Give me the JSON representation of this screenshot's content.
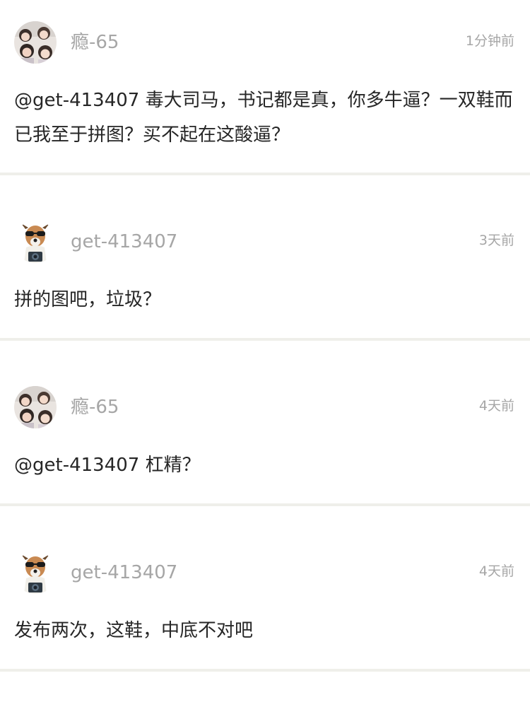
{
  "comments": [
    {
      "username": "瘾-65",
      "time": "1分钟前",
      "text": "@get-413407 毒大司马，书记都是真，你多牛逼？一双鞋而已我至于拼图？买不起在这酸逼？",
      "avatar": "girls-photo-avatar"
    },
    {
      "username": "get-413407",
      "time": "3天前",
      "text": "拼的图吧，垃圾？",
      "avatar": "dog-sunglasses-avatar"
    },
    {
      "username": "瘾-65",
      "time": "4天前",
      "text": "@get-413407 杠精？",
      "avatar": "girls-photo-avatar"
    },
    {
      "username": "get-413407",
      "time": "4天前",
      "text": "发布两次，这鞋，中底不对吧",
      "avatar": "dog-sunglasses-avatar"
    }
  ]
}
